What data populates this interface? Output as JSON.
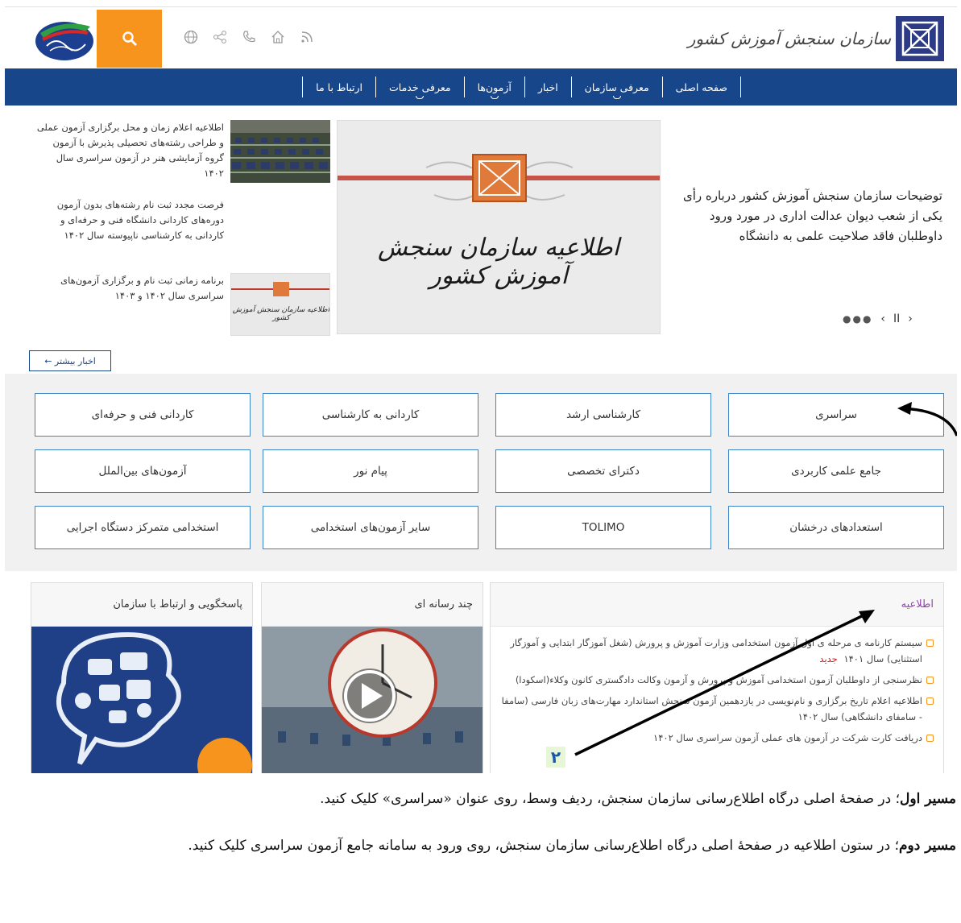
{
  "header": {
    "org_name": "سازمان سنجش آموزش کشور",
    "icons": [
      "globe-icon",
      "share-icon",
      "phone-icon",
      "home-icon",
      "rss-icon"
    ]
  },
  "nav": {
    "items": [
      "صفحه اصلی",
      "معرفی سازمان",
      "اخبار",
      "آزمون‌ها",
      "معرفی خدمات",
      "ارتباط با ما"
    ]
  },
  "slider": {
    "headline": "توضیحات سازمان سنجش آموزش کشور درباره رأی یکی از شعب دیوان عدالت اداری در مورد ورود داوطلبان فاقد صلاحیت علمی به دانشگاه",
    "image_title": "اطلاعیه سازمان سنجش آموزش کشور",
    "controls": {
      "next": "›",
      "pause": "II",
      "prev": "‹",
      "dots": "●●●"
    }
  },
  "side_news": [
    {
      "text": "اطلاعیه اعلام زمان و محل برگزاری آزمون عملی و طراحی رشته‌های تحصیلی پذیرش با آزمون گروه آزمایشی هنر در آزمون سراسری سال ۱۴۰۲"
    },
    {
      "text": "فرصت مجدد ثبت نام رشته‌های بدون آزمون دوره‌های کاردانی دانشگاه فنی و حرفه‌ای و کاردانی به کارشناسی ناپیوسته سال ۱۴۰۲"
    },
    {
      "text": "برنامه زمانی ثبت نام و برگزاری آزمون‌های سراسری سال ۱۴۰۲ و ۱۴۰۳",
      "thumb_text": "اطلاعیه سازمان سنجش آموزش کشور"
    }
  ],
  "more_news": "اخبار بیشتر ←",
  "categories": [
    [
      "سراسری",
      "کارشناسی ارشد",
      "کاردانی به کارشناسی",
      "کاردانی فنی و حرفه‌ای"
    ],
    [
      "جامع علمی کاربردی",
      "دکترای تخصصی",
      "پیام نور",
      "آزمون‌های بین‌الملل"
    ],
    [
      "استعدادهای درخشان",
      "TOLIMO",
      "سایر آزمون‌های استخدامی",
      "استخدامی متمرکز دستگاه اجرایی"
    ]
  ],
  "cards": {
    "notice": {
      "title": "اطلاعیه",
      "items": [
        {
          "text": "سیستم کارنامه ی مرحله ی اول آزمون استخدامی وزارت آموزش و پرورش (شغل آموزگار ابتدایی و آموزگار استثنایی) سال ۱۴۰۱",
          "tag": "جدید"
        },
        {
          "text": "نظرسنجی از داوطلبان آزمون استخدامی آموزش و پرورش و آزمون وکالت دادگستری کانون وکلاء(اسکودا)"
        },
        {
          "text": "اطلاعیه اعلام تاریخ برگزاری و نام‌نویسی در یازدهمین آزمون سنجش استاندارد مهارت‌های زبان فارسی (سامفا - سامفای دانشگاهی) سال ۱۴۰۲"
        },
        {
          "text": "دریافت کارت شرکت در آزمون های عملی آزمون سراسری سال ۱۴۰۲"
        }
      ]
    },
    "media": {
      "title": "چند رسانه ای"
    },
    "contact": {
      "title": "پاسخگویی و ارتباط با سازمان"
    }
  },
  "marker": "۲",
  "instructions": {
    "path1_label": "مسیر اول",
    "path1_text": "؛ در صفحهٔ اصلی درگاه اطلاع‌رسانی سازمان سنجش، ردیف وسط، روی عنوان «سراسری» کلیک کنید.",
    "path2_label": "مسیر دوم",
    "path2_text": "؛ در ستون اطلاعیه در صفحهٔ اصلی درگاه اطلاع‌رسانی سازمان سنجش، روی ورود به سامانه جامع آزمون سراسری کلیک کنید."
  },
  "colors": {
    "nav": "#17468a",
    "accent": "#f7941d",
    "cat_border": "#3e86c7",
    "new": "#d31f26"
  }
}
